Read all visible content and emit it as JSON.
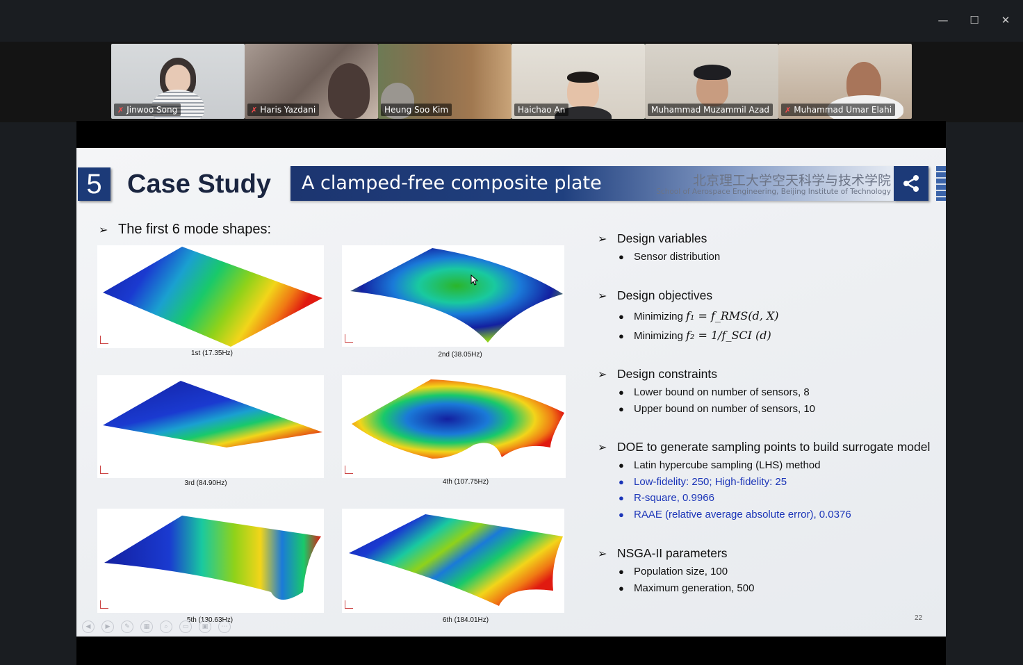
{
  "window": {
    "minimize_icon": "minimize-icon",
    "maximize_icon": "maximize-icon",
    "close_icon": "close-icon"
  },
  "participants": [
    {
      "name": "Jinwoo Song",
      "muted": true,
      "bg": "#cfd3d6"
    },
    {
      "name": "Haris Yazdani",
      "muted": true,
      "bg": "#8a7872"
    },
    {
      "name": "Heung Soo Kim",
      "muted": false,
      "bg": "#7a6e5c"
    },
    {
      "name": "Haichao An",
      "muted": false,
      "bg": "#d9d4cc",
      "active_speaker": true
    },
    {
      "name": "Muhammad Muzammil Azad",
      "muted": false,
      "bg": "#c9c4bc"
    },
    {
      "name": "Muhammad Umar Elahi",
      "muted": true,
      "bg": "#bdb1a6"
    }
  ],
  "slide": {
    "section_number": "5",
    "title": "Case Study",
    "banner_title": "A clamped-free composite plate",
    "institution_cn": "北京理工大学空天科学与技术学院",
    "institution_en": "School of Aerospace Engineering, Beijing Institute of Technology",
    "modes_heading": "The first 6 mode shapes:",
    "modes": [
      {
        "caption": "1st (17.35Hz)"
      },
      {
        "caption": "2nd (38.05Hz)"
      },
      {
        "caption": "3rd (84.90Hz)"
      },
      {
        "caption": "4th (107.75Hz)"
      },
      {
        "caption": "5th (130.63Hz)"
      },
      {
        "caption": "6th (184.01Hz)"
      }
    ],
    "sections": [
      {
        "heading": "Design variables",
        "items": [
          {
            "text": "Sensor distribution"
          }
        ]
      },
      {
        "heading": "Design objectives",
        "items": [
          {
            "text": "Minimizing",
            "math": "f₁ = f_RMS(d, X)"
          },
          {
            "text": "Minimizing",
            "math": "f₂ = 1/f_SCI (d)"
          }
        ]
      },
      {
        "heading": "Design constraints",
        "items": [
          {
            "text": "Lower bound on number of sensors, 8"
          },
          {
            "text": "Upper bound on number of sensors, 10"
          }
        ]
      },
      {
        "heading": "DOE to generate sampling points to build surrogate model",
        "items": [
          {
            "text": "Latin hypercube sampling (LHS) method"
          },
          {
            "text": "Low-fidelity: 250; High-fidelity: 25",
            "color": "#1b35b8"
          },
          {
            "text": "R-square, 0.9966",
            "color": "#1b35b8"
          },
          {
            "text": "RAAE (relative average absolute error), 0.0376",
            "color": "#1b35b8"
          }
        ]
      },
      {
        "heading": "NSGA-II parameters",
        "items": [
          {
            "text": "Population size, 100"
          },
          {
            "text": "Maximum generation, 500"
          }
        ]
      }
    ],
    "page_number": "22"
  }
}
